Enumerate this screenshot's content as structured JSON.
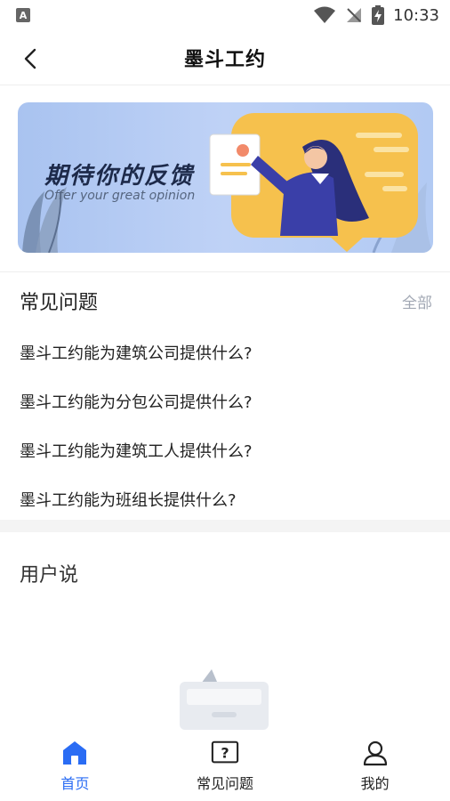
{
  "status_bar": {
    "app_indicator": "A",
    "time": "10:33"
  },
  "nav": {
    "title": "墨斗工约"
  },
  "banner": {
    "title": "期待你的反馈",
    "subtitle": "Offer your great opinion"
  },
  "faq": {
    "title": "常见问题",
    "all_link": "全部",
    "items": [
      {
        "text": "墨斗工约能为建筑公司提供什么?"
      },
      {
        "text": "墨斗工约能为分包公司提供什么?"
      },
      {
        "text": "墨斗工约能为建筑工人提供什么?"
      },
      {
        "text": "墨斗工约能为班组长提供什么?"
      }
    ]
  },
  "user_says": {
    "title": "用户说"
  },
  "tab_bar": {
    "tabs": [
      {
        "label": "首页",
        "icon": "home-icon",
        "active": true
      },
      {
        "label": "常见问题",
        "icon": "question-icon",
        "active": false
      },
      {
        "label": "我的",
        "icon": "user-icon",
        "active": false
      }
    ]
  },
  "colors": {
    "accent": "#2a6cf4",
    "banner_bg": "#b5cbf3",
    "banner_card": "#f6c14d",
    "figure": "#3a3fa8"
  }
}
